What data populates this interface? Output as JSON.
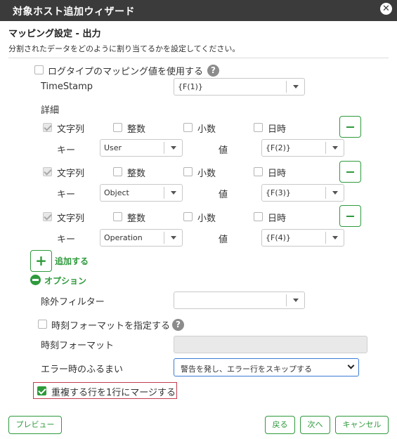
{
  "window": {
    "title": "対象ホスト追加ウィザード",
    "close_glyph": "✕"
  },
  "header": {
    "title": "マッピング設定 - 出力",
    "description": "分割されたデータをどのように割り当てるかを設定してください。"
  },
  "logtype": {
    "label": "ログタイプのマッピング値を使用する",
    "checked": false,
    "help_glyph": "?"
  },
  "timestamp": {
    "label": "TimeStamp",
    "value": "{F(1)}"
  },
  "details": {
    "label": "詳細",
    "type_labels": {
      "string": "文字列",
      "integer": "整数",
      "decimal": "小数",
      "datetime": "日時"
    },
    "key_label": "キー",
    "value_label": "値",
    "rows": [
      {
        "key": "User",
        "value": "{F(2)}",
        "string_checked": true
      },
      {
        "key": "Object",
        "value": "{F(3)}",
        "string_checked": true
      },
      {
        "key": "Operation",
        "value": "{F(4)}",
        "string_checked": true
      }
    ],
    "add_label": "追加する",
    "add_glyph": "+"
  },
  "options": {
    "label": "オプション",
    "exclude_filter": {
      "label": "除外フィルター",
      "value": ""
    },
    "time_format_toggle": {
      "label": "時刻フォーマットを指定する",
      "checked": false
    },
    "time_format": {
      "label": "時刻フォーマット",
      "value": ""
    },
    "error_behavior": {
      "label": "エラー時のふるまい",
      "value": "警告を発し、エラー行をスキップする"
    },
    "merge": {
      "label": "重複する行を1行にマージする",
      "checked": true
    }
  },
  "footer": {
    "preview": "プレビュー",
    "back": "戻る",
    "next": "次へ",
    "cancel": "キャンセル"
  },
  "colors": {
    "accent": "#2e9a3c",
    "titlebar": "#3b3b3b",
    "merge_border": "#c23b4e",
    "select_focus": "#3a7bd5"
  }
}
